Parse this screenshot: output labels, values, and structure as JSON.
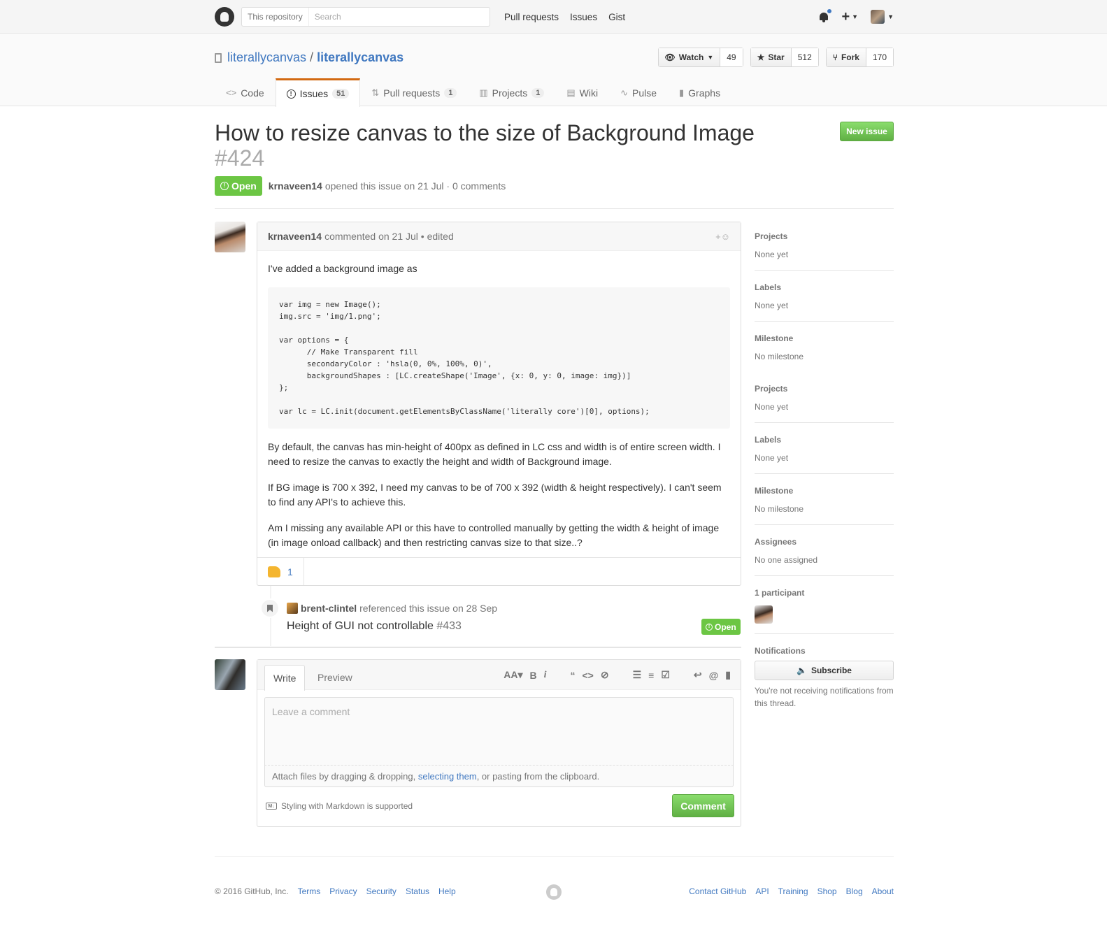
{
  "header": {
    "search_scope": "This repository",
    "search_placeholder": "Search",
    "nav": [
      "Pull requests",
      "Issues",
      "Gist"
    ]
  },
  "repo": {
    "owner": "literallycanvas",
    "separator": "/",
    "name": "literallycanvas",
    "watch_label": "Watch",
    "watch_count": "49",
    "star_label": "Star",
    "star_count": "512",
    "fork_label": "Fork",
    "fork_count": "170",
    "tabs": [
      {
        "label": "Code",
        "icon": "code-icon"
      },
      {
        "label": "Issues",
        "count": "51",
        "icon": "issue-icon",
        "selected": true
      },
      {
        "label": "Pull requests",
        "count": "1",
        "icon": "pr-icon"
      },
      {
        "label": "Projects",
        "count": "1",
        "icon": "project-icon"
      },
      {
        "label": "Wiki",
        "icon": "book-icon"
      },
      {
        "label": "Pulse",
        "icon": "pulse-icon"
      },
      {
        "label": "Graphs",
        "icon": "graph-icon"
      }
    ]
  },
  "issue": {
    "title": "How to resize canvas to the size of Background Image",
    "number": "#424",
    "new_issue_label": "New issue",
    "state": "Open",
    "author": "krnaveen14",
    "meta_text": "opened this issue on 21 Jul · 0 comments"
  },
  "comment": {
    "author": "krnaveen14",
    "meta": "commented on 21 Jul • edited",
    "reaction_glyph": "+☺",
    "intro": "I've added a background image as",
    "code": "var img = new Image();\nimg.src = 'img/1.png';\n\nvar options = {\n      // Make Transparent fill\n      secondaryColor : 'hsla(0, 0%, 100%, 0)',\n      backgroundShapes : [LC.createShape('Image', {x: 0, y: 0, image: img})]\n};\n\nvar lc = LC.init(document.getElementsByClassName('literally core')[0], options);",
    "p1": "By default, the canvas has min-height of 400px as defined in LC css and width is of entire screen width. I need to resize the canvas to exactly the height and width of Background image.",
    "p2": "If BG image is 700 x 392, I need my canvas to be of 700 x 392 (width & height respectively). I can't seem to find any API's to achieve this.",
    "p3": "Am I missing any available API or this have to controlled manually by getting the width & height of image (in image onload callback) and then restricting canvas size to that size..?",
    "thumbs_up_count": "1"
  },
  "event": {
    "author": "brent-clintel",
    "text": "referenced this issue on 28 Sep",
    "ref_title": "Height of GUI not controllable",
    "ref_number": "#433",
    "ref_state": "Open"
  },
  "form": {
    "tab_write": "Write",
    "tab_preview": "Preview",
    "toolbar": [
      "AA▾",
      "B",
      "i",
      "“",
      "<>",
      "⊘",
      "☰",
      "≡",
      "☑",
      "↩",
      "@",
      "▮"
    ],
    "placeholder": "Leave a comment",
    "attach_prefix": "Attach files by dragging & dropping, ",
    "attach_link": "selecting them",
    "attach_suffix": ", or pasting from the clipboard.",
    "markdown_note": "Styling with Markdown is supported",
    "markdown_badge": "M↓",
    "submit_label": "Comment"
  },
  "sidebar": {
    "sections": [
      {
        "heading": "Projects",
        "value": "None yet"
      },
      {
        "heading": "Labels",
        "value": "None yet"
      },
      {
        "heading": "Milestone",
        "value": "No milestone"
      },
      {
        "heading": "Projects",
        "value": "None yet"
      },
      {
        "heading": "Labels",
        "value": "None yet"
      },
      {
        "heading": "Milestone",
        "value": "No milestone"
      },
      {
        "heading": "Assignees",
        "value": "No one assigned"
      }
    ],
    "participants_heading": "1 participant",
    "notifications_heading": "Notifications",
    "subscribe_label": "Subscribe",
    "notification_reason": "You're not receiving notifications from this thread."
  },
  "footer": {
    "copyright": "© 2016 GitHub, Inc.",
    "left_links": [
      "Terms",
      "Privacy",
      "Security",
      "Status",
      "Help"
    ],
    "right_links": [
      "Contact GitHub",
      "API",
      "Training",
      "Shop",
      "Blog",
      "About"
    ]
  }
}
